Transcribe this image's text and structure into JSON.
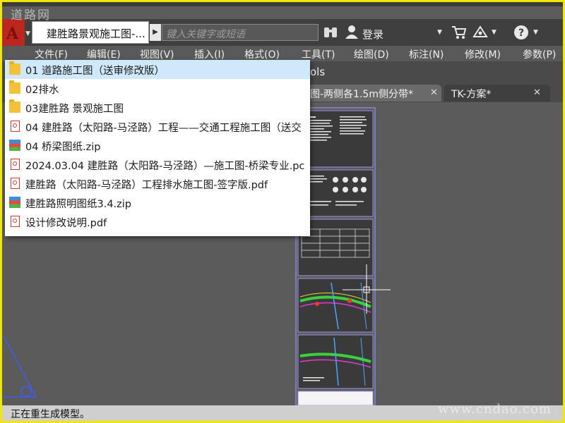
{
  "watermarks": {
    "top": "道路网",
    "bottom": "www.cndao.com"
  },
  "titlebar": {
    "file_title": "建胜路景观施工图-...",
    "search_placeholder": "键入关键字或短语",
    "signin_label": "登录"
  },
  "menubar": {
    "items": [
      "文件(F)",
      "编辑(E)",
      "视图(V)",
      "插入(I)",
      "格式(O)",
      "工具(T)",
      "绘图(D)",
      "标注(N)",
      "修改(M)",
      "参数(P)"
    ]
  },
  "ribbon": {
    "partial_label": "ols"
  },
  "doc_tabs": {
    "active_label": "图-两侧各1.5m侧分带*",
    "second_label": "TK-方案*"
  },
  "dropdown": {
    "items": [
      {
        "label": "01 道路施工图（送审修改版）",
        "type": "folder",
        "selected": true
      },
      {
        "label": "02排水",
        "type": "folder",
        "selected": false
      },
      {
        "label": "03建胜路 景观施工图",
        "type": "folder",
        "selected": false
      },
      {
        "label": "04 建胜路（太阳路-马泾路）工程——交通工程施工图（送交",
        "type": "pdf",
        "selected": false
      },
      {
        "label": "04 桥梁图纸.zip",
        "type": "zip",
        "selected": false
      },
      {
        "label": "2024.03.04  建胜路（太阳路-马泾路）—施工图-桥梁专业.pc",
        "type": "pdf",
        "selected": false
      },
      {
        "label": "建胜路（太阳路-马泾路）工程排水施工图-签字版.pdf",
        "type": "pdf",
        "selected": false
      },
      {
        "label": "建胜路照明图纸3.4.zip",
        "type": "zip",
        "selected": false
      },
      {
        "label": "设计修改说明.pdf",
        "type": "pdf",
        "selected": false
      }
    ]
  },
  "status": {
    "text": "正在重生成模型。"
  },
  "colors": {
    "frame": "#f3e600",
    "selection": "#cfe8fb",
    "logo": "#b9271f",
    "canvas": "#5b5b5b"
  },
  "icons": [
    "autocad-logo-icon",
    "binoculars-icon",
    "user-icon",
    "cart-icon",
    "exchange-icon",
    "help-icon",
    "close-icon",
    "crosshair-cursor-icon"
  ]
}
